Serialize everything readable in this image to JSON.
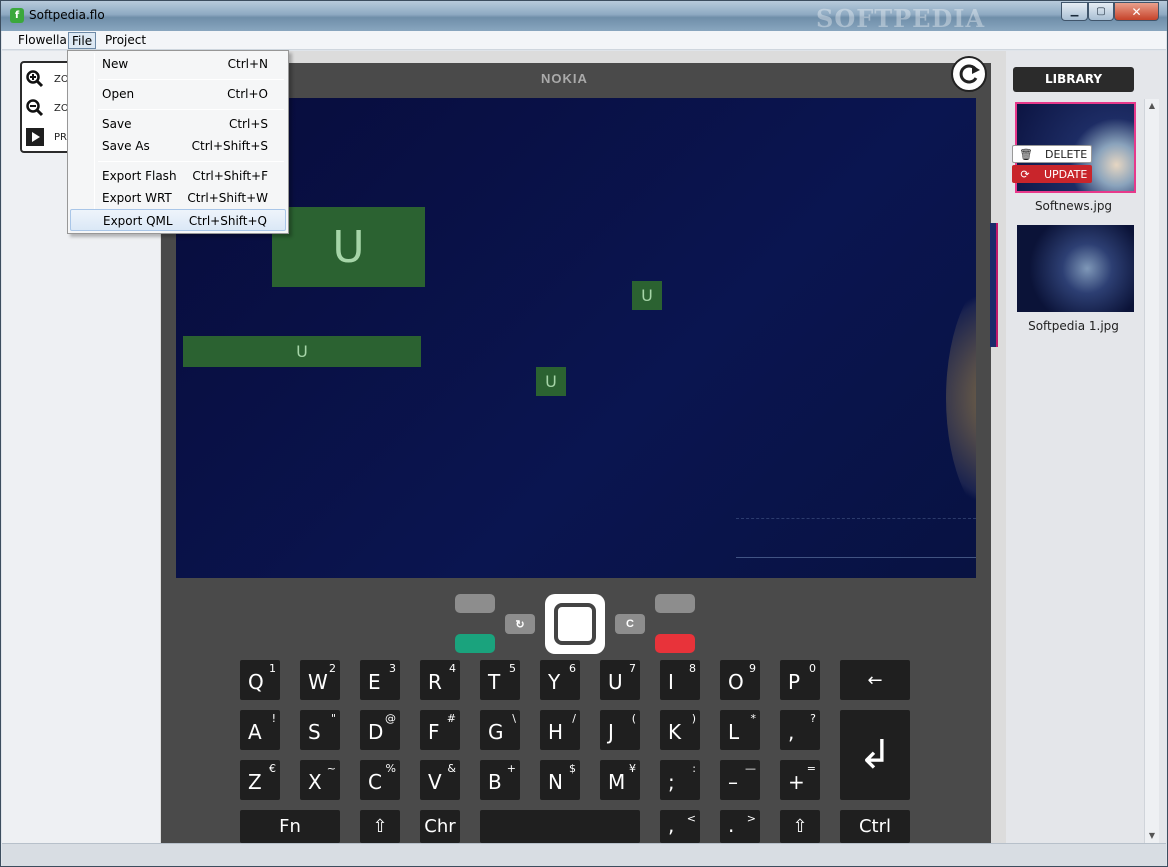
{
  "window": {
    "title": "Softpedia.flo",
    "brand": "SOFTPEDIA",
    "app_icon_letter": "f"
  },
  "menubar": {
    "items": [
      {
        "label": "Flowella"
      },
      {
        "label": "File"
      },
      {
        "label": "Project"
      }
    ]
  },
  "file_menu": {
    "items": [
      {
        "label": "New",
        "shortcut": "Ctrl+N"
      },
      {
        "label": "Open",
        "shortcut": "Ctrl+O"
      },
      {
        "label": "Save",
        "shortcut": "Ctrl+S"
      },
      {
        "label": "Save As",
        "shortcut": "Ctrl+Shift+S"
      },
      {
        "label": "Export Flash",
        "shortcut": "Ctrl+Shift+F"
      },
      {
        "label": "Export WRT",
        "shortcut": "Ctrl+Shift+W"
      },
      {
        "label": "Export QML",
        "shortcut": "Ctrl+Shift+Q"
      }
    ]
  },
  "toolbox": {
    "zoom_in_label": "ZO",
    "zoom_out_label": "ZO",
    "preview_label": "PR"
  },
  "device": {
    "brand": "NOKIA",
    "hotspot_glyph": "U",
    "mini_key_left": "↻",
    "mini_key_right": "C",
    "colors": {
      "call": "#1aa37d",
      "end": "#e8333a",
      "soft": "#8d8d8d"
    }
  },
  "keyboard": {
    "row1": [
      {
        "main": "Q",
        "sub": "1"
      },
      {
        "main": "W",
        "sub": "2"
      },
      {
        "main": "E",
        "sub": "3"
      },
      {
        "main": "R",
        "sub": "4"
      },
      {
        "main": "T",
        "sub": "5"
      },
      {
        "main": "Y",
        "sub": "6"
      },
      {
        "main": "U",
        "sub": "7"
      },
      {
        "main": "I",
        "sub": "8"
      },
      {
        "main": "O",
        "sub": "9"
      },
      {
        "main": "P",
        "sub": "0"
      }
    ],
    "row2": [
      {
        "main": "A",
        "sub": "!"
      },
      {
        "main": "S",
        "sub": "\""
      },
      {
        "main": "D",
        "sub": "@"
      },
      {
        "main": "F",
        "sub": "#"
      },
      {
        "main": "G",
        "sub": "\\"
      },
      {
        "main": "H",
        "sub": "/"
      },
      {
        "main": "J",
        "sub": "("
      },
      {
        "main": "K",
        "sub": ")"
      },
      {
        "main": "L",
        "sub": "*"
      },
      {
        "main": ",",
        "sub": "?"
      }
    ],
    "row3": [
      {
        "main": "Z",
        "sub": "€"
      },
      {
        "main": "X",
        "sub": "~"
      },
      {
        "main": "C",
        "sub": "%"
      },
      {
        "main": "V",
        "sub": "&"
      },
      {
        "main": "B",
        "sub": "+"
      },
      {
        "main": "N",
        "sub": "$"
      },
      {
        "main": "M",
        "sub": "¥"
      },
      {
        "main": ";",
        "sub": ":"
      },
      {
        "main": "–",
        "sub": "—"
      },
      {
        "main": "+",
        "sub": "="
      }
    ],
    "backspace": "←",
    "enter": "↲",
    "fn": "Fn",
    "shift": "⇧",
    "chr": "Chr",
    "comma": {
      "main": ",",
      "sub": "<"
    },
    "period": {
      "main": ".",
      "sub": ">"
    },
    "ctrl": "Ctrl"
  },
  "library": {
    "title": "LIBRARY",
    "context_delete": "DELETE",
    "context_update": "UPDATE",
    "items": [
      {
        "caption": "Softnews.jpg"
      },
      {
        "caption": "Softpedia 1.jpg"
      }
    ]
  }
}
